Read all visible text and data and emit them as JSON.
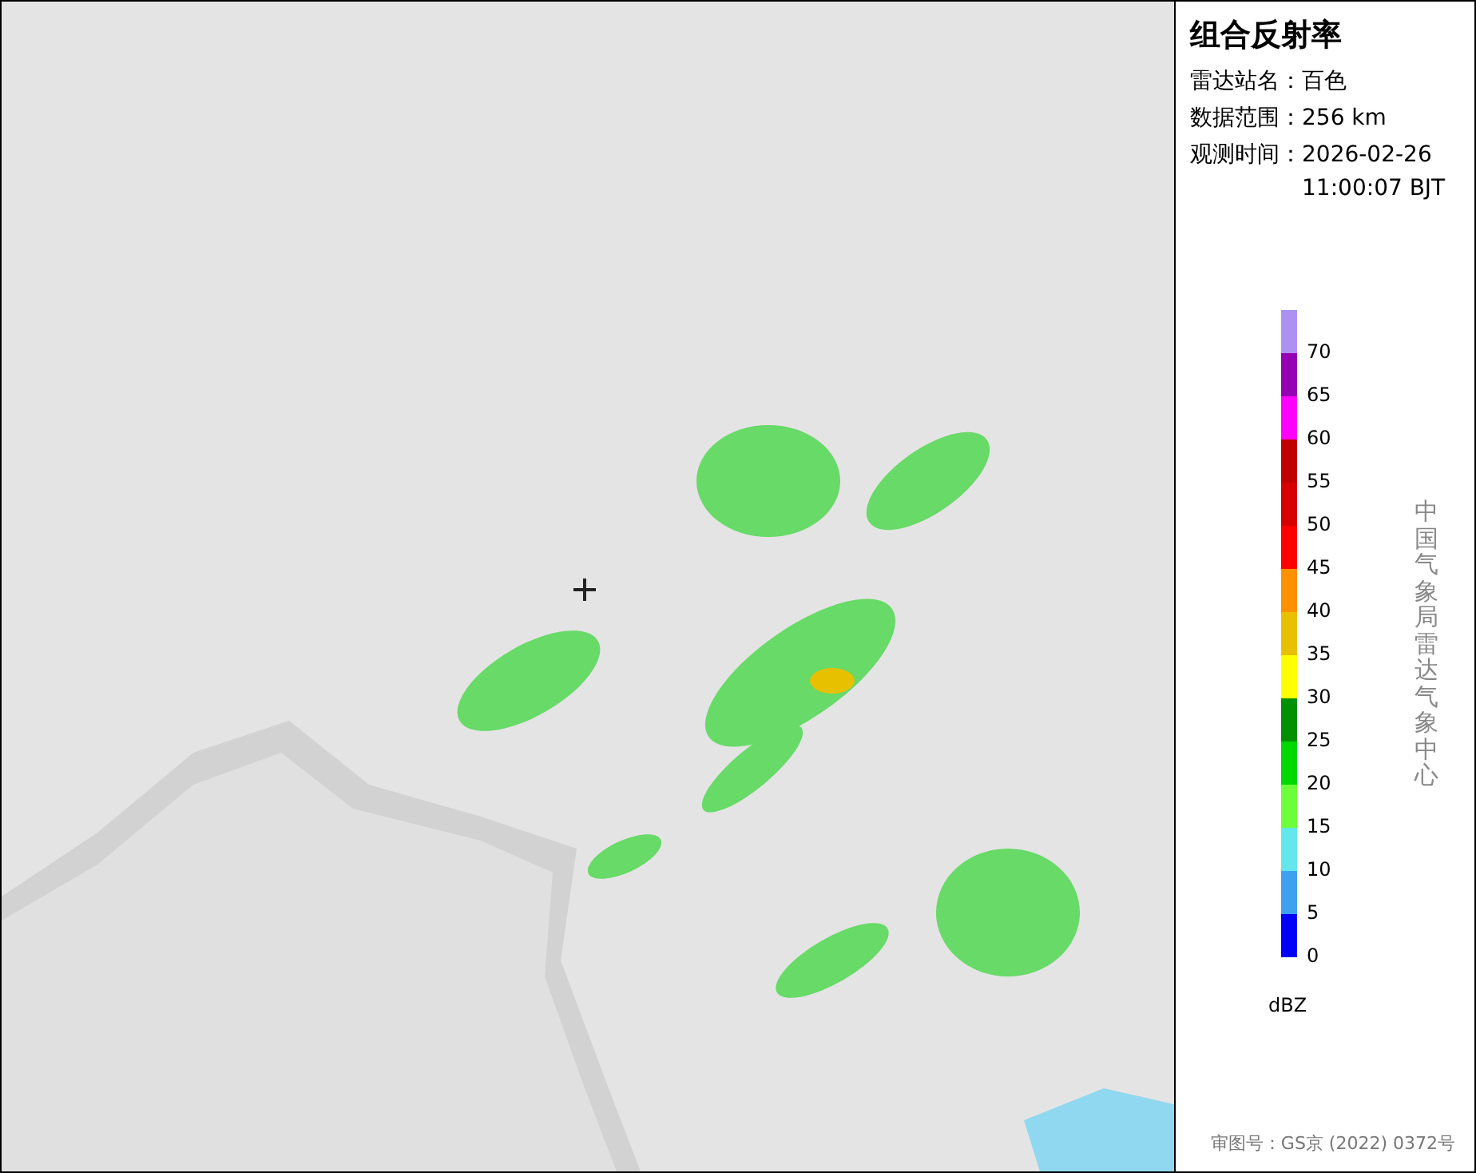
{
  "panel": {
    "title": "组合反射率",
    "fields": [
      {
        "label": "雷达站名：",
        "value": "百色"
      },
      {
        "label": "数据范围：",
        "value": "256 km"
      },
      {
        "label": "观测时间：",
        "value": "2026-02-26 11:00:07 BJT"
      }
    ]
  },
  "legend": {
    "segments": [
      {
        "color": "#ad91f0"
      },
      {
        "color": "#9600b4"
      },
      {
        "color": "#ff00ff"
      },
      {
        "color": "#c00000"
      },
      {
        "color": "#d60000"
      },
      {
        "color": "#ff0000"
      },
      {
        "color": "#ff9000"
      },
      {
        "color": "#e7c000"
      },
      {
        "color": "#ffff00"
      },
      {
        "color": "#009000"
      },
      {
        "color": "#00d800"
      },
      {
        "color": "#6eff3c"
      },
      {
        "color": "#64e7eb"
      },
      {
        "color": "#40a0f0"
      },
      {
        "color": "#0000f6"
      }
    ],
    "labels": [
      "70",
      "65",
      "60",
      "55",
      "50",
      "45",
      "40",
      "35",
      "30",
      "25",
      "20",
      "15",
      "10",
      "5",
      "0"
    ],
    "unit": "dBZ"
  },
  "source": "中国气象局雷达气象中心",
  "approval": "审图号：GS京 (2022) 0372号"
}
